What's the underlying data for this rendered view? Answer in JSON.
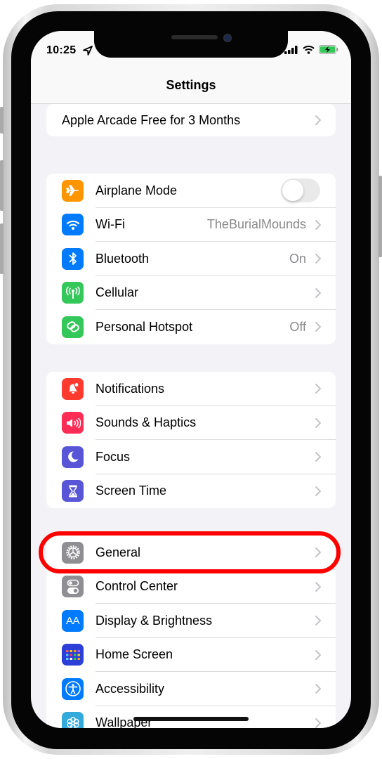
{
  "status_bar": {
    "time": "10:25",
    "icons": [
      "location-arrow-icon",
      "cellular-signal-icon",
      "wifi-signal-icon",
      "battery-charging-icon"
    ]
  },
  "header": {
    "title": "Settings"
  },
  "promo": {
    "label": "Apple Arcade Free for 3 Months"
  },
  "groups": [
    {
      "items": [
        {
          "label": "Airplane Mode",
          "icon": "airplane-icon",
          "color": "#ff9500",
          "toggle": false
        },
        {
          "label": "Wi-Fi",
          "icon": "wifi-icon",
          "color": "#007aff",
          "value": "TheBurialMounds"
        },
        {
          "label": "Bluetooth",
          "icon": "bluetooth-icon",
          "color": "#007aff",
          "value": "On"
        },
        {
          "label": "Cellular",
          "icon": "antenna-icon",
          "color": "#34c759",
          "value": ""
        },
        {
          "label": "Personal Hotspot",
          "icon": "hotspot-link-icon",
          "color": "#34c759",
          "value": "Off"
        }
      ]
    },
    {
      "items": [
        {
          "label": "Notifications",
          "icon": "notification-bell-icon",
          "color": "#ff3b30"
        },
        {
          "label": "Sounds & Haptics",
          "icon": "speaker-icon",
          "color": "#ff2d55"
        },
        {
          "label": "Focus",
          "icon": "moon-icon",
          "color": "#5856d6"
        },
        {
          "label": "Screen Time",
          "icon": "hourglass-icon",
          "color": "#5856d6"
        }
      ]
    },
    {
      "items": [
        {
          "label": "General",
          "icon": "gear-icon",
          "color": "#8e8e93",
          "highlighted": true
        },
        {
          "label": "Control Center",
          "icon": "switches-icon",
          "color": "#8e8e93"
        },
        {
          "label": "Display & Brightness",
          "icon": "text-size-icon",
          "color": "#007aff",
          "glyph": "AA"
        },
        {
          "label": "Home Screen",
          "icon": "app-grid-icon",
          "color": "#2c3fd6"
        },
        {
          "label": "Accessibility",
          "icon": "accessibility-person-icon",
          "color": "#007aff"
        },
        {
          "label": "Wallpaper",
          "icon": "flower-icon",
          "color": "#34aadc"
        }
      ]
    }
  ],
  "annotation": {
    "highlight_color": "#ff0000",
    "highlighted_item": "General"
  }
}
